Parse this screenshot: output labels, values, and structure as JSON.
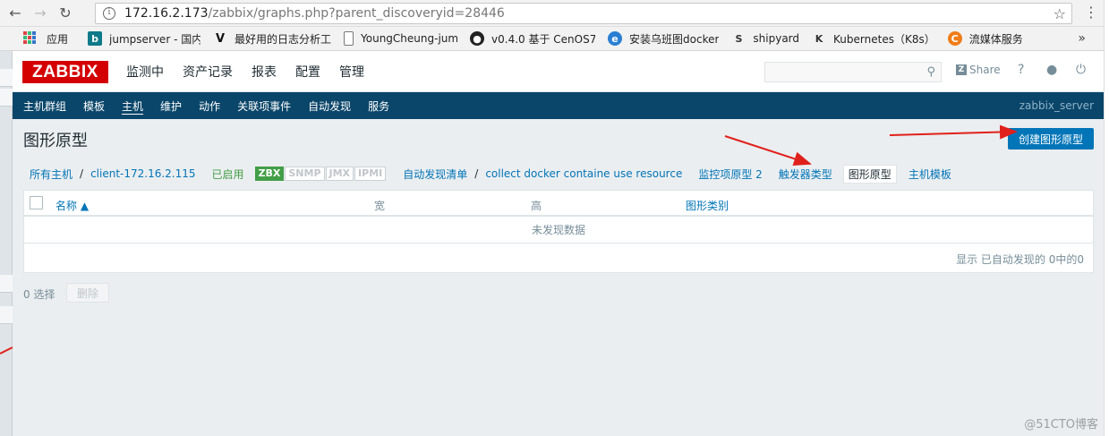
{
  "browser": {
    "url_host": "172.16.2.173",
    "url_path": "/zabbix/graphs.php?parent_discoveryid=28446",
    "bookmarks": [
      {
        "label": "应用",
        "icon": "apps-icon"
      },
      {
        "label": "jumpserver - 国内...",
        "icon": "bing-icon"
      },
      {
        "label": "最好用的日志分析工",
        "icon": "v-logo-icon"
      },
      {
        "label": "YoungCheung-jum",
        "icon": "page-icon"
      },
      {
        "label": "v0.4.0 基于 CenOS7",
        "icon": "github-icon"
      },
      {
        "label": "安装乌班图docker",
        "icon": "ie-icon"
      },
      {
        "label": "shipyard",
        "icon": "s-logo-icon"
      },
      {
        "label": "Kubernetes（K8s）",
        "icon": "k-logo-icon"
      },
      {
        "label": "流媒体服务",
        "icon": "flame-icon"
      }
    ],
    "more": "»"
  },
  "header": {
    "logo": "ZABBIX",
    "menu": [
      "监测中",
      "资产记录",
      "报表",
      "配置",
      "管理"
    ],
    "share": "Share",
    "help": "?",
    "colors": {
      "logo": "#d40000",
      "nav": "#0a466a",
      "link": "#0275b8",
      "enabled": "#429e47"
    }
  },
  "sub_nav": {
    "items": [
      "主机群组",
      "模板",
      "主机",
      "维护",
      "动作",
      "关联项事件",
      "自动发现",
      "服务"
    ],
    "active": "主机",
    "server": "zabbix_server"
  },
  "page": {
    "title": "图形原型",
    "create_button": "创建图形原型"
  },
  "breadcrumbs": {
    "all_hosts": "所有主机",
    "sep": "/",
    "host": "client-172.16.2.115",
    "status": "已启用",
    "tags": [
      "ZBX",
      "SNMP",
      "JMX",
      "IPMI"
    ],
    "discovery_list": "自动发现清单",
    "rule": "collect docker containe use resource",
    "item_prototypes": "监控项原型 2",
    "trigger_prototypes": "触发器类型",
    "graph_prototypes": "图形原型",
    "host_prototypes": "主机模板"
  },
  "table": {
    "columns": [
      "名称 ▲",
      "宽",
      "高",
      "图形类别"
    ],
    "empty": "未发现数据",
    "footer": "显示 已自动发现的 0中的0"
  },
  "actions": {
    "selected": "0 选择",
    "delete": "删除"
  },
  "watermark": "@51CTO博客"
}
